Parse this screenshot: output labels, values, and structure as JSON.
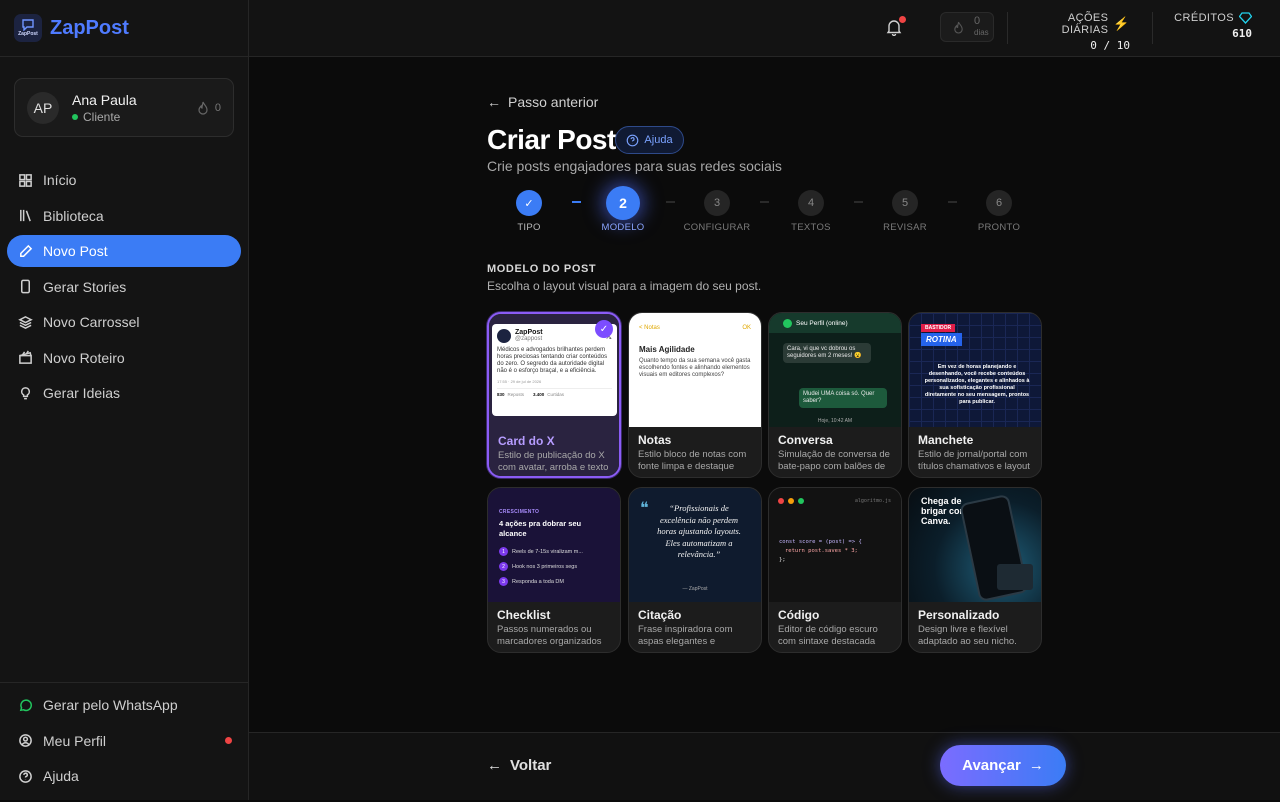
{
  "brand": {
    "name": "ZapPost",
    "logo_text": "ZapPost"
  },
  "user": {
    "initials": "AP",
    "name": "Ana Paula",
    "role": "Cliente",
    "streak": "0"
  },
  "nav": [
    {
      "label": "Início",
      "icon": "grid-icon"
    },
    {
      "label": "Biblioteca",
      "icon": "library-icon"
    },
    {
      "label": "Novo Post",
      "icon": "pen-icon",
      "active": true
    },
    {
      "label": "Gerar Stories",
      "icon": "phone-icon"
    },
    {
      "label": "Novo Carrossel",
      "icon": "layers-icon"
    },
    {
      "label": "Novo Roteiro",
      "icon": "clapper-icon"
    },
    {
      "label": "Gerar Ideias",
      "icon": "bulb-icon"
    }
  ],
  "bottom_nav": [
    {
      "label": "Gerar pelo WhatsApp",
      "icon": "whatsapp-icon"
    },
    {
      "label": "Meu Perfil",
      "icon": "profile-icon"
    },
    {
      "label": "Ajuda",
      "icon": "help-icon"
    }
  ],
  "topbar": {
    "days_num": "0",
    "days_label": "dias",
    "daily_actions_label": "AÇÕES DIÁRIAS",
    "daily_actions_value": "0 / 10",
    "credits_label": "CRÉDITOS",
    "credits_value": "610"
  },
  "page": {
    "back_label": "Passo anterior",
    "title": "Criar Post",
    "help_label": "Ajuda",
    "subtitle": "Crie posts engajadores para suas redes sociais",
    "section_title": "MODELO DO POST",
    "section_sub": "Escolha o layout visual para a imagem do seu post."
  },
  "steps": [
    {
      "num": "✓",
      "label": "TIPO",
      "state": "done"
    },
    {
      "num": "2",
      "label": "MODELO",
      "state": "current"
    },
    {
      "num": "3",
      "label": "CONFIGURAR",
      "state": "todo"
    },
    {
      "num": "4",
      "label": "TEXTOS",
      "state": "todo"
    },
    {
      "num": "5",
      "label": "REVISAR",
      "state": "todo"
    },
    {
      "num": "6",
      "label": "PRONTO",
      "state": "todo"
    }
  ],
  "templates": [
    {
      "name": "Card do X",
      "desc": "Estilo de publicação do X com avatar, arroba e texto",
      "selected": true
    },
    {
      "name": "Notas",
      "desc": "Estilo bloco de notas com fonte limpa e destaque"
    },
    {
      "name": "Conversa",
      "desc": "Simulação de conversa de bate-papo com balões de"
    },
    {
      "name": "Manchete",
      "desc": "Estilo de jornal/portal com títulos chamativos e layout"
    },
    {
      "name": "Checklist",
      "desc": "Passos numerados ou marcadores organizados"
    },
    {
      "name": "Citação",
      "desc": "Frase inspiradora com aspas elegantes e"
    },
    {
      "name": "Código",
      "desc": "Editor de código escuro com sintaxe destacada"
    },
    {
      "name": "Personalizado",
      "desc": "Design livre e flexível adaptado ao seu nicho."
    }
  ],
  "previews": {
    "x_card": {
      "name": "ZapPost",
      "handle": "@zappost",
      "text": "Médicos e advogados brilhantes perdem horas preciosas tentando criar conteúdos do zero. O segredo da autoridade digital não é o esforço braçal, e a eficiência.",
      "time": "17:55 · 29 de jul de 2026",
      "reposts": "830",
      "reposts_lbl": "Reposts",
      "likes": "3.400",
      "likes_lbl": "Curtidas"
    },
    "notes": {
      "back": "< Notas",
      "ok": "OK",
      "heading": "Mais Agilidade",
      "body": "Quanto tempo da sua semana você gasta escolhendo fontes e alinhando elementos visuais em editores complexos?"
    },
    "chat": {
      "profile": "Seu Perfil (online)",
      "msg1": "Cara, vi que vc dobrou os seguidores em 2 meses! 😮",
      "msg2": "Mudei UMA coisa só. Quer saber?",
      "time": "Hoje, 10:42 AM"
    },
    "headline": {
      "tag1": "BASTIDOR",
      "tag2": "ROTINA",
      "body": "Em vez de horas planejando e desenhando, você recebe conteúdos personalizados, elegantes e alinhados à sua sofisticação profissional diretamente no seu mensagem, prontos para publicar."
    },
    "checklist": {
      "tag": "CRESCIMENTO",
      "title": "4 ações pra dobrar seu alcance",
      "items": [
        "Reels de 7-15s viralizam m...",
        "Hook nos 3 primeiros segs",
        "Responda a toda DM"
      ]
    },
    "quote": {
      "text": "“Profissionais de excelência não perdem horas ajustando layouts. Eles automatizam a relevância.”",
      "author": "— ZapPost"
    },
    "code": {
      "file": "algoritmo.js",
      "line1": "const score = (post) => {",
      "line2": "return post.saves * 3;",
      "line3": "};"
    },
    "custom": {
      "text": "Chega de brigar com o Canva."
    }
  },
  "footer": {
    "back_label": "Voltar",
    "next_label": "Avançar"
  },
  "colors": {
    "accent": "#3b7cf5",
    "selected": "#8b5cf6",
    "brand": "#4f7bff"
  }
}
